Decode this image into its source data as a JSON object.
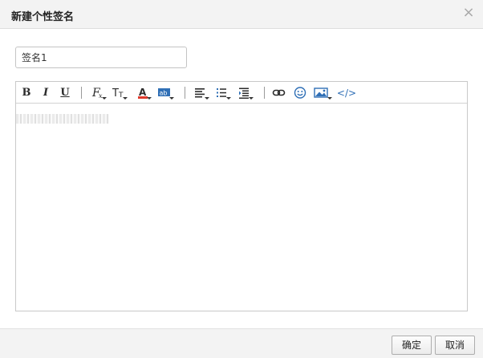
{
  "dialog": {
    "title": "新建个性签名",
    "close_icon": "close-icon"
  },
  "form": {
    "name_value": "签名1"
  },
  "editor": {
    "toolbar": [
      {
        "name": "bold-icon",
        "glyph": "B"
      },
      {
        "name": "italic-icon",
        "glyph": "I"
      },
      {
        "name": "underline-icon",
        "glyph": "U"
      },
      {
        "name": "font-family-icon"
      },
      {
        "name": "font-size-icon"
      },
      {
        "name": "font-color-icon",
        "color": "#e0392b"
      },
      {
        "name": "highlight-color-icon",
        "color": "#2f6fb6"
      },
      {
        "name": "align-icon"
      },
      {
        "name": "list-icon"
      },
      {
        "name": "indent-icon"
      },
      {
        "name": "link-icon"
      },
      {
        "name": "emoticon-icon"
      },
      {
        "name": "image-icon"
      },
      {
        "name": "source-code-icon",
        "glyph": "</>"
      }
    ]
  },
  "footer": {
    "ok_label": "确定",
    "cancel_label": "取消"
  },
  "colors": {
    "icon_blue": "#2f6fb6",
    "font_color_bar": "#e0392b"
  }
}
